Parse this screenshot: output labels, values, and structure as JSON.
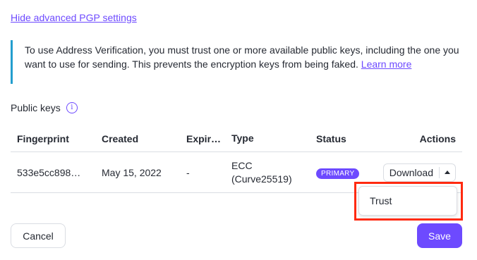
{
  "toggle_link": "Hide advanced PGP settings",
  "info": {
    "text": "To use Address Verification, you must trust one or more available public keys, including the one you want to use for sending. This prevents the encryption keys from being faked.",
    "learn_more": "Learn more"
  },
  "public_keys": {
    "label": "Public keys",
    "info_icon": "info-icon",
    "columns": [
      "Fingerprint",
      "Created",
      "Expir…",
      "Type",
      "Status",
      "Actions"
    ],
    "rows": [
      {
        "fingerprint": "533e5cc898…",
        "created": "May 15, 2022",
        "expires": "-",
        "type_line1": "ECC",
        "type_line2": "(Curve25519)",
        "status": "PRIMARY",
        "action": "Download"
      }
    ]
  },
  "dropdown": {
    "items": [
      "Trust"
    ]
  },
  "footer": {
    "cancel": "Cancel",
    "save": "Save"
  },
  "colors": {
    "accent": "#6d4aff",
    "info_border": "#239ece",
    "highlight": "#ff2a10"
  }
}
